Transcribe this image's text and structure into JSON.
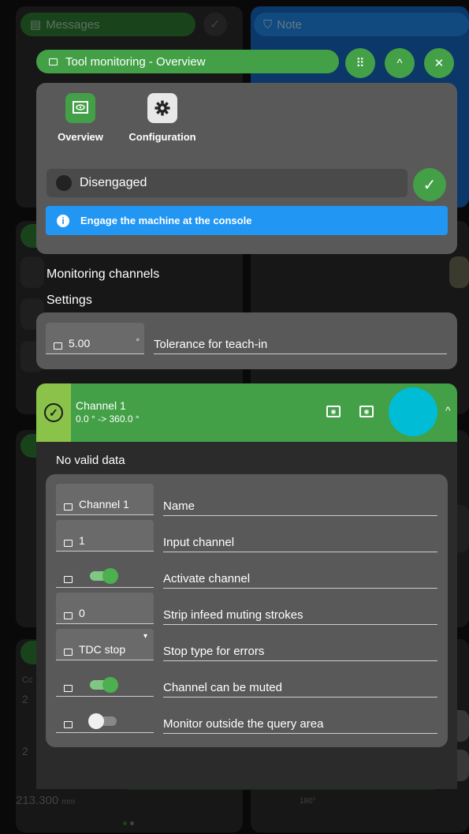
{
  "background": {
    "messages_title": "Messages",
    "note_title": "Note",
    "value_text": "213.300",
    "value_unit": "mm",
    "angle_text": "180°",
    "side_char": "2",
    "side_char2": "Cc"
  },
  "window": {
    "title": "Tool monitoring - Overview",
    "grid_icon": "apps-icon",
    "collapse_icon": "chevron-up-icon",
    "close_icon": "close-icon"
  },
  "apps": [
    {
      "label": "Overview",
      "icon": "overview-icon",
      "color": "#43a047"
    },
    {
      "label": "Configuration",
      "icon": "gear-icon",
      "color": "#e0e0e0"
    }
  ],
  "status": {
    "label": "Disengaged",
    "info": "Engage the machine at the console"
  },
  "sections": {
    "monitoring": "Monitoring channels",
    "settings": "Settings"
  },
  "tolerance": {
    "value": "5.00",
    "unit": "°",
    "label": "Tolerance for teach-in"
  },
  "channel": {
    "name": "Channel 1",
    "range": "0.0 ° -> 360.0 °",
    "status_color": "#00bcd4",
    "no_data": "No valid data",
    "fields": [
      {
        "value": "Channel 1",
        "label": "Name",
        "kind": "text"
      },
      {
        "value": "1",
        "label": "Input channel",
        "kind": "text"
      },
      {
        "value": "",
        "label": "Activate channel",
        "kind": "toggle",
        "on": true
      },
      {
        "value": "0",
        "label": "Strip infeed muting strokes",
        "kind": "text"
      },
      {
        "value": "TDC stop",
        "label": "Stop type for errors",
        "kind": "select"
      },
      {
        "value": "",
        "label": "Channel can be muted",
        "kind": "toggle",
        "on": true
      },
      {
        "value": "",
        "label": "Monitor outside the query area",
        "kind": "toggle",
        "on": false
      }
    ]
  },
  "colors": {
    "accent_green": "#43a047",
    "info_blue": "#2196f3",
    "signal_red": "#e53935"
  }
}
